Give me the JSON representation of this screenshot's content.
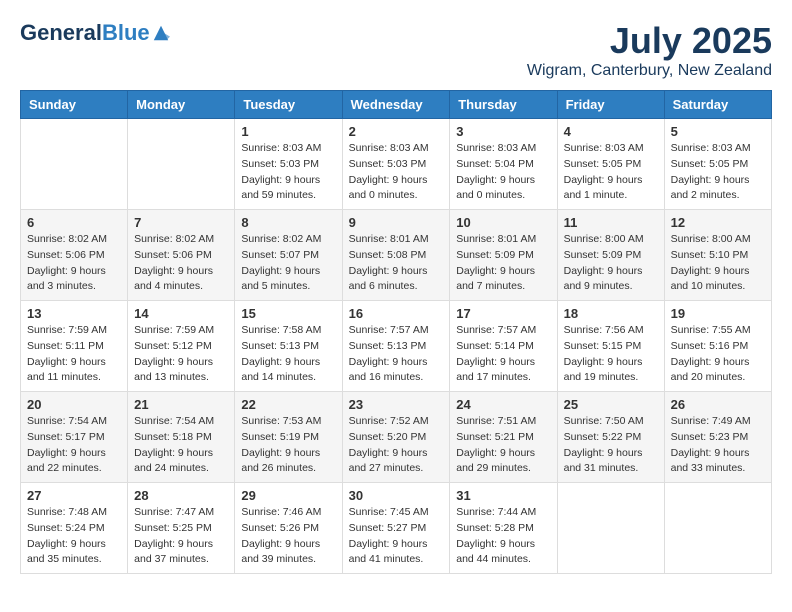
{
  "header": {
    "logo_general": "General",
    "logo_blue": "Blue",
    "month_title": "July 2025",
    "location": "Wigram, Canterbury, New Zealand"
  },
  "weekdays": [
    "Sunday",
    "Monday",
    "Tuesday",
    "Wednesday",
    "Thursday",
    "Friday",
    "Saturday"
  ],
  "weeks": [
    [
      {
        "day": "",
        "info": ""
      },
      {
        "day": "",
        "info": ""
      },
      {
        "day": "1",
        "info": "Sunrise: 8:03 AM\nSunset: 5:03 PM\nDaylight: 9 hours\nand 59 minutes."
      },
      {
        "day": "2",
        "info": "Sunrise: 8:03 AM\nSunset: 5:03 PM\nDaylight: 9 hours\nand 0 minutes."
      },
      {
        "day": "3",
        "info": "Sunrise: 8:03 AM\nSunset: 5:04 PM\nDaylight: 9 hours\nand 0 minutes."
      },
      {
        "day": "4",
        "info": "Sunrise: 8:03 AM\nSunset: 5:05 PM\nDaylight: 9 hours\nand 1 minute."
      },
      {
        "day": "5",
        "info": "Sunrise: 8:03 AM\nSunset: 5:05 PM\nDaylight: 9 hours\nand 2 minutes."
      }
    ],
    [
      {
        "day": "6",
        "info": "Sunrise: 8:02 AM\nSunset: 5:06 PM\nDaylight: 9 hours\nand 3 minutes."
      },
      {
        "day": "7",
        "info": "Sunrise: 8:02 AM\nSunset: 5:06 PM\nDaylight: 9 hours\nand 4 minutes."
      },
      {
        "day": "8",
        "info": "Sunrise: 8:02 AM\nSunset: 5:07 PM\nDaylight: 9 hours\nand 5 minutes."
      },
      {
        "day": "9",
        "info": "Sunrise: 8:01 AM\nSunset: 5:08 PM\nDaylight: 9 hours\nand 6 minutes."
      },
      {
        "day": "10",
        "info": "Sunrise: 8:01 AM\nSunset: 5:09 PM\nDaylight: 9 hours\nand 7 minutes."
      },
      {
        "day": "11",
        "info": "Sunrise: 8:00 AM\nSunset: 5:09 PM\nDaylight: 9 hours\nand 9 minutes."
      },
      {
        "day": "12",
        "info": "Sunrise: 8:00 AM\nSunset: 5:10 PM\nDaylight: 9 hours\nand 10 minutes."
      }
    ],
    [
      {
        "day": "13",
        "info": "Sunrise: 7:59 AM\nSunset: 5:11 PM\nDaylight: 9 hours\nand 11 minutes."
      },
      {
        "day": "14",
        "info": "Sunrise: 7:59 AM\nSunset: 5:12 PM\nDaylight: 9 hours\nand 13 minutes."
      },
      {
        "day": "15",
        "info": "Sunrise: 7:58 AM\nSunset: 5:13 PM\nDaylight: 9 hours\nand 14 minutes."
      },
      {
        "day": "16",
        "info": "Sunrise: 7:57 AM\nSunset: 5:13 PM\nDaylight: 9 hours\nand 16 minutes."
      },
      {
        "day": "17",
        "info": "Sunrise: 7:57 AM\nSunset: 5:14 PM\nDaylight: 9 hours\nand 17 minutes."
      },
      {
        "day": "18",
        "info": "Sunrise: 7:56 AM\nSunset: 5:15 PM\nDaylight: 9 hours\nand 19 minutes."
      },
      {
        "day": "19",
        "info": "Sunrise: 7:55 AM\nSunset: 5:16 PM\nDaylight: 9 hours\nand 20 minutes."
      }
    ],
    [
      {
        "day": "20",
        "info": "Sunrise: 7:54 AM\nSunset: 5:17 PM\nDaylight: 9 hours\nand 22 minutes."
      },
      {
        "day": "21",
        "info": "Sunrise: 7:54 AM\nSunset: 5:18 PM\nDaylight: 9 hours\nand 24 minutes."
      },
      {
        "day": "22",
        "info": "Sunrise: 7:53 AM\nSunset: 5:19 PM\nDaylight: 9 hours\nand 26 minutes."
      },
      {
        "day": "23",
        "info": "Sunrise: 7:52 AM\nSunset: 5:20 PM\nDaylight: 9 hours\nand 27 minutes."
      },
      {
        "day": "24",
        "info": "Sunrise: 7:51 AM\nSunset: 5:21 PM\nDaylight: 9 hours\nand 29 minutes."
      },
      {
        "day": "25",
        "info": "Sunrise: 7:50 AM\nSunset: 5:22 PM\nDaylight: 9 hours\nand 31 minutes."
      },
      {
        "day": "26",
        "info": "Sunrise: 7:49 AM\nSunset: 5:23 PM\nDaylight: 9 hours\nand 33 minutes."
      }
    ],
    [
      {
        "day": "27",
        "info": "Sunrise: 7:48 AM\nSunset: 5:24 PM\nDaylight: 9 hours\nand 35 minutes."
      },
      {
        "day": "28",
        "info": "Sunrise: 7:47 AM\nSunset: 5:25 PM\nDaylight: 9 hours\nand 37 minutes."
      },
      {
        "day": "29",
        "info": "Sunrise: 7:46 AM\nSunset: 5:26 PM\nDaylight: 9 hours\nand 39 minutes."
      },
      {
        "day": "30",
        "info": "Sunrise: 7:45 AM\nSunset: 5:27 PM\nDaylight: 9 hours\nand 41 minutes."
      },
      {
        "day": "31",
        "info": "Sunrise: 7:44 AM\nSunset: 5:28 PM\nDaylight: 9 hours\nand 44 minutes."
      },
      {
        "day": "",
        "info": ""
      },
      {
        "day": "",
        "info": ""
      }
    ]
  ]
}
